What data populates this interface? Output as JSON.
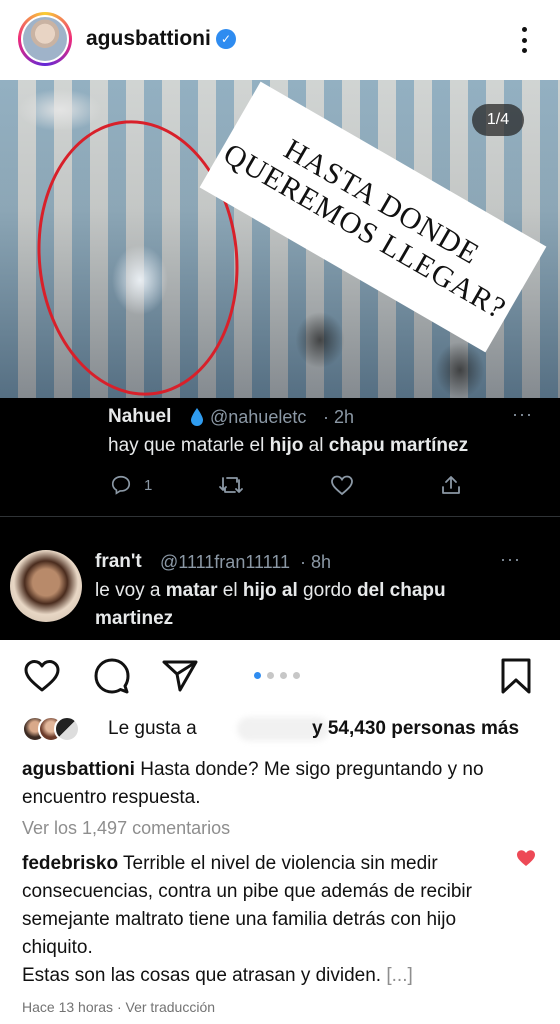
{
  "header": {
    "username": "agusbattioni",
    "verified_icon": "verified-badge-icon",
    "more_icon": "more-vertical-icon"
  },
  "media": {
    "counter": "1/4",
    "overlay_text_line1": "HASTA DONDE",
    "overlay_text_line2": "QUEREMOS LLEGAR?",
    "highlight_color": "#d8202a",
    "tweets": [
      {
        "name": "Nahuel",
        "handle": "@nahueletc",
        "time": "· 2h",
        "text_plain_1": "hay que matarle el ",
        "text_bold_1": "hijo",
        "text_plain_2": " al ",
        "text_bold_2": "chapu martínez",
        "reply_count": "1",
        "more": "···"
      },
      {
        "name": "fran't",
        "handle": "@1111fran11111",
        "time": "· 8h",
        "text_plain_1": "le voy a ",
        "text_bold_1": "matar",
        "text_plain_2": " el ",
        "text_bold_2": "hijo al",
        "text_plain_3": " gordo ",
        "text_bold_3": "del chapu martinez",
        "more": "···"
      }
    ]
  },
  "actions": {
    "like_icon": "heart-icon",
    "comment_icon": "comment-icon",
    "share_icon": "send-icon",
    "save_icon": "bookmark-icon",
    "carousel_position": 1,
    "carousel_total": 4,
    "active_dot_color": "#2f8cf0"
  },
  "likes": {
    "prefix": "Le gusta a",
    "suffix": "y 54,430 personas más"
  },
  "caption": {
    "username": "agusbattioni",
    "text": "Hasta donde? Me sigo preguntando y no encuentro respuesta."
  },
  "view_comments": "Ver los 1,497 comentarios",
  "top_comment": {
    "username": "fedebrisko",
    "text": "Terrible el nivel de violencia sin medir consecuencias, contra un pibe que además de recibir semejante maltrato tiene una familia detrás con hijo chiquito.",
    "text2": "Estas son las cosas que atrasan y dividen.",
    "more": "[...]",
    "heart_color": "#ed4956"
  },
  "footer": {
    "time": "Hace 13 horas",
    "separator": " · ",
    "translate": "Ver traducción"
  }
}
